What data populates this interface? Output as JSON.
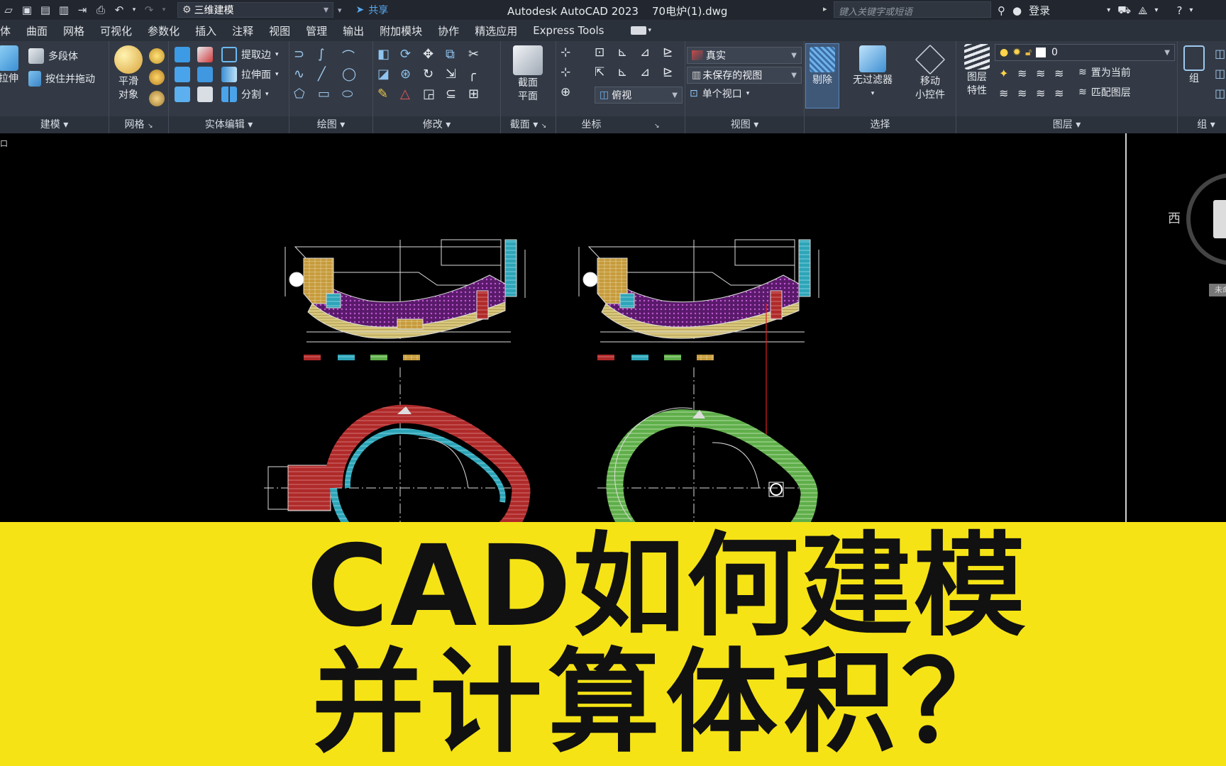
{
  "titlebar": {
    "workspace": "三维建模",
    "share": "共享",
    "app_title": "Autodesk AutoCAD 2023",
    "file_name": "70电炉(1).dwg",
    "search_placeholder": "键入关键字或短语",
    "login": "登录"
  },
  "menu": [
    "体",
    "曲面",
    "网格",
    "可视化",
    "参数化",
    "插入",
    "注释",
    "视图",
    "管理",
    "输出",
    "附加模块",
    "协作",
    "精选应用",
    "Express Tools"
  ],
  "ribbon": {
    "panels": {
      "modeling": "建模",
      "mesh": "网格",
      "solid_edit": "实体编辑",
      "draw": "绘图",
      "modify": "修改",
      "section": "截面",
      "coords": "坐标",
      "view": "视图",
      "selection": "选择",
      "layers": "图层",
      "groups": "组"
    },
    "buttons": {
      "extrude": "拉伸",
      "polysolid": "多段体",
      "presspull": "按住并拖动",
      "smooth_line1": "平滑",
      "smooth_line2": "对象",
      "extract_edges": "提取边",
      "extrude_faces": "拉伸面",
      "separate": "分割",
      "section_line1": "截面",
      "section_line2": "平面",
      "culling": "剔除",
      "no_filter": "无过滤器",
      "gizmo_line1": "移动",
      "gizmo_line2": "小控件",
      "layer_props_line1": "图层",
      "layer_props_line2": "特性",
      "make_current": "置为当前",
      "match_layer": "匹配图层",
      "group": "组"
    },
    "combos": {
      "visual_style": "真实",
      "view": "未保存的视图",
      "viewport": "单个视口",
      "ucs_view": "俯视",
      "layer": "0"
    }
  },
  "viewport": {
    "label": "口",
    "viewcube_west": "西",
    "viewcube_unnamed": "未命"
  },
  "banner": {
    "line1": "CAD如何建模",
    "line2": "并计算体积？"
  }
}
